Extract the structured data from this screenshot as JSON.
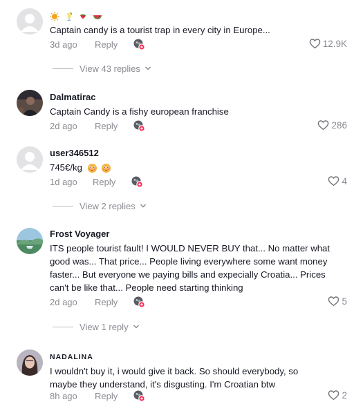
{
  "comments": [
    {
      "username": "",
      "text": "Captain candy is a tourist trap in every city in Europe...",
      "date": "3d ago",
      "reply_label": "Reply",
      "likes": "12.9K"
    },
    {
      "username": "Dalmatirac",
      "text": "Captain Candy is a fishy european franchise",
      "date": "2d ago",
      "reply_label": "Reply",
      "likes": "286"
    },
    {
      "username": "user346512",
      "text": "745€/kg",
      "date": "1d ago",
      "reply_label": "Reply",
      "likes": "4"
    },
    {
      "username": "Frost Voyager",
      "text": "ITS people tourist fault! I WOULD NEVER BUY that... No matter what good was... That price... People living everywhere some want money faster... But everyone we paying bills and expecially Croatia... Prices can't be like that... People need starting thinking",
      "date": "2d ago",
      "reply_label": "Reply",
      "likes": "5"
    },
    {
      "username": "NADALINA",
      "text": "I wouldn't buy it, i would give it back. So should everybody, so maybe they understand, it's disgusting. I'm Croatian btw",
      "date": "8h ago",
      "reply_label": "Reply",
      "likes": "2"
    }
  ],
  "view_replies": [
    "View 43 replies",
    "View 2 replies",
    "View 1 reply"
  ],
  "icons": {
    "like": "heart-outline-icon",
    "reaction": "sticker-reaction-icon",
    "expand": "chevron-down-icon"
  },
  "colors": {
    "text": "#161823",
    "secondary": "#8a8b91",
    "accent": "#fe2c55"
  }
}
